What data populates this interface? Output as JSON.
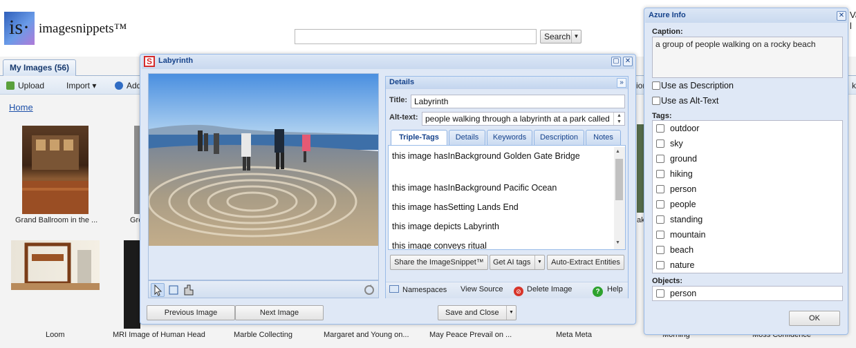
{
  "app": {
    "logo_glyph": "is·",
    "logo_text": "imagesnippets™",
    "search_button": "Search",
    "right_edge_text": "Va\nl"
  },
  "tabs": {
    "my_images": "My Images (56)"
  },
  "toolbar": {
    "upload": "Upload",
    "import": "Import ▾",
    "add": "Add",
    "partial_right": "ior",
    "partial_far": "k"
  },
  "breadcrumb": {
    "home": "Home"
  },
  "gallery": {
    "row1": [
      {
        "caption": "Grand Ballroom in the ..."
      },
      {
        "caption": "Gre"
      },
      {
        "caption": "ak"
      }
    ],
    "row2": [
      {
        "caption": "Loom"
      },
      {
        "caption": "MRI Image of Human Head"
      },
      {
        "caption": "Marble Collecting"
      },
      {
        "caption": "Margaret and Young on..."
      },
      {
        "caption": "May Peace Prevail on ..."
      },
      {
        "caption": "Meta Meta"
      },
      {
        "caption": "Morning"
      },
      {
        "caption": "Moss Confidence"
      }
    ]
  },
  "dialog": {
    "title": "Labyrinth",
    "details_header": "Details",
    "title_label": "Title:",
    "title_value": "Labyrinth",
    "alt_label": "Alt-text:",
    "alt_value": "people walking through a labyrinth at a park called",
    "tabs": [
      "Triple-Tags",
      "Details",
      "Keywords",
      "Description",
      "Notes"
    ],
    "triples": [
      "this image hasInBackground Golden Gate Bridge",
      "this image hasInBackground Pacific Ocean",
      "this image hasSetting Lands End",
      "this image depicts Labyrinth",
      "this image conveys ritual"
    ],
    "share_button": "Share the ImageSnippet™",
    "ai_tags_button": "Get AI tags",
    "auto_extract_button": "Auto-Extract Entities",
    "namespaces": "Namespaces",
    "view_source": "View Source",
    "delete_image": "Delete Image",
    "help": "Help",
    "prev_button": "Previous Image",
    "next_button": "Next Image",
    "save_close_button": "Save and Close"
  },
  "azure": {
    "title": "Azure Info",
    "caption_label": "Caption:",
    "caption_value": "a group of people walking on a rocky beach",
    "use_description": "Use as Description",
    "use_alt": "Use as Alt-Text",
    "tags_label": "Tags:",
    "tags": [
      "outdoor",
      "sky",
      "ground",
      "hiking",
      "person",
      "people",
      "standing",
      "mountain",
      "beach",
      "nature"
    ],
    "objects_label": "Objects:",
    "objects": [
      "person"
    ],
    "ok_button": "OK"
  }
}
